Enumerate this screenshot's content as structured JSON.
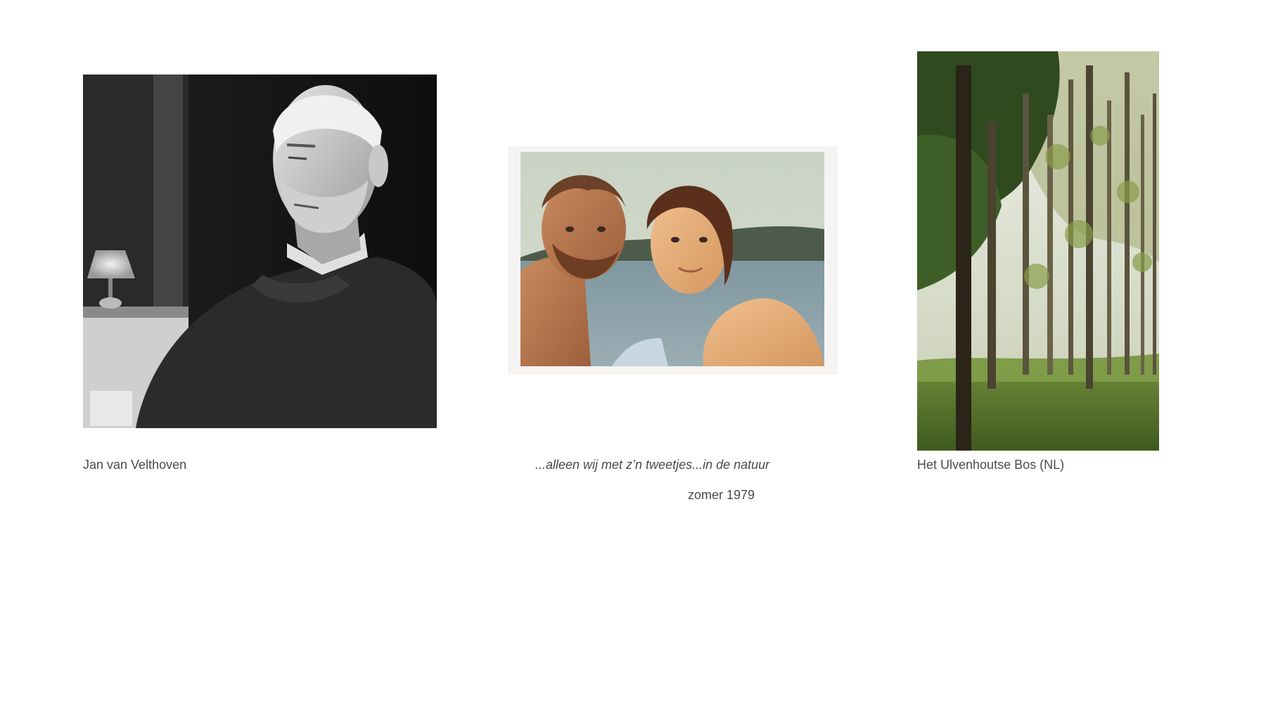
{
  "gallery": {
    "items": [
      {
        "caption": "Jan van Velthoven",
        "photo_kind": "black-and-white portrait"
      },
      {
        "caption": "...alleen wij met z’n tweetjes...in de natuur",
        "subcaption": "zomer 1979",
        "photo_kind": "vintage color photograph"
      },
      {
        "caption": "Het Ulvenhoutse Bos (NL)",
        "photo_kind": "forest photograph"
      }
    ]
  },
  "colors": {
    "background": "#ffffff",
    "caption_text": "#4a4a4a"
  }
}
